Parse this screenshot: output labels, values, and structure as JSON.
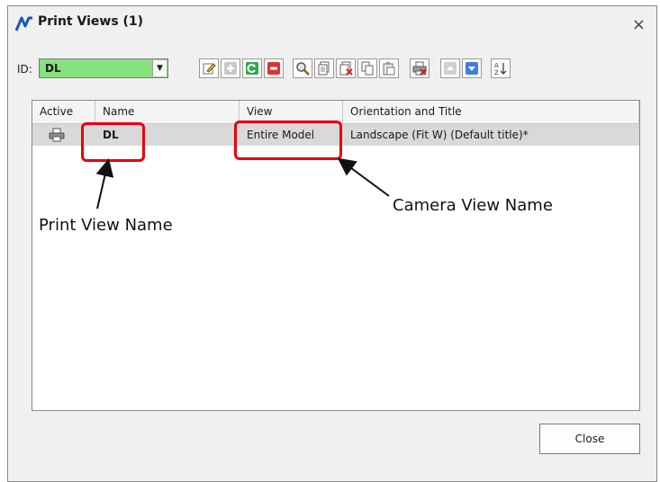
{
  "window": {
    "title": "Print Views (1)",
    "close_glyph": "×"
  },
  "toolbar": {
    "id_label": "ID:",
    "id_value": "DL",
    "buttons": [
      "edit-icon",
      "add-icon",
      "refresh-icon",
      "remove-icon",
      "zoom-icon",
      "copy-icon",
      "copy-delete-icon",
      "duplicate-icon",
      "paste-icon",
      "print-delete-icon",
      "move-up-icon",
      "move-down-icon",
      "sort-az-icon"
    ]
  },
  "table": {
    "columns": [
      "Active",
      "Name",
      "View",
      "Orientation and Title"
    ],
    "rows": [
      {
        "active_icon": "printer-icon",
        "name": "DL",
        "view": "Entire Model",
        "orientation": "Landscape (Fit W) (Default title)*"
      }
    ]
  },
  "annotations": {
    "print_view_name": "Print View Name",
    "camera_view_name": "Camera View Name",
    "highlight_color": "#e8000b"
  },
  "footer": {
    "close_label": "Close"
  }
}
